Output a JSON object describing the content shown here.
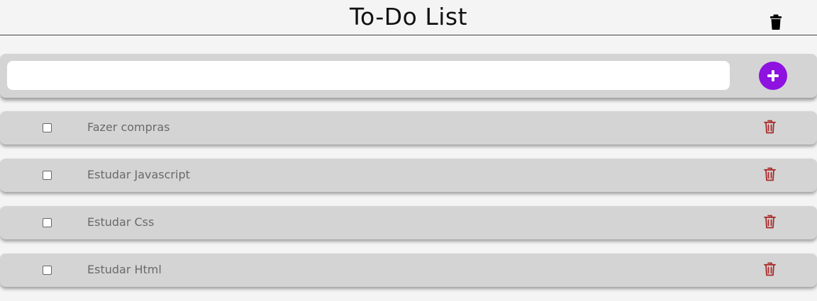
{
  "header": {
    "title": "To-Do List",
    "clear_all_icon": "trash-icon"
  },
  "add_bar": {
    "input_value": "",
    "input_placeholder": "",
    "add_icon": "plus-icon"
  },
  "tasks": [
    {
      "label": "Fazer compras",
      "checked": false
    },
    {
      "label": "Estudar Javascript",
      "checked": false
    },
    {
      "label": "Estudar Css",
      "checked": false
    },
    {
      "label": "Estudar Html",
      "checked": false
    }
  ],
  "colors": {
    "accent": "#8e12e0",
    "delete": "#a82a2a",
    "task_bg": "#d4d4d4"
  }
}
